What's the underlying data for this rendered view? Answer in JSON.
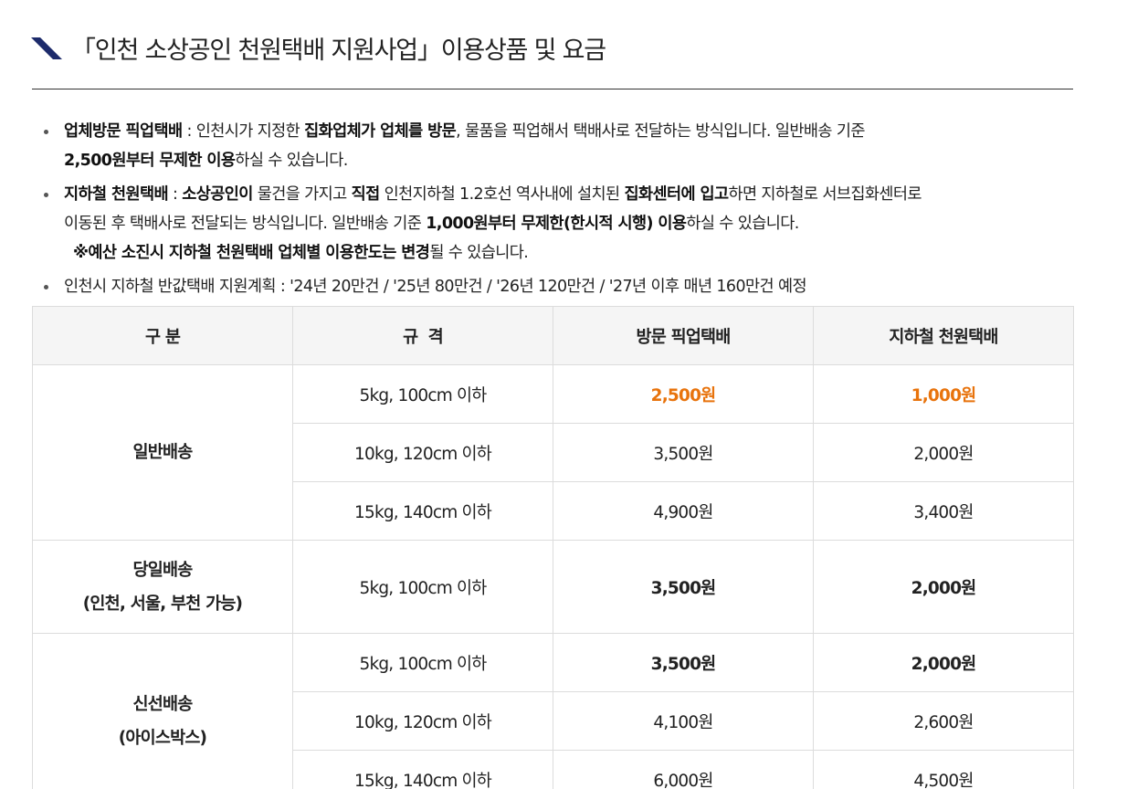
{
  "title": "「인천 소상공인 천원택배 지원사업」이용상품 및 요금",
  "accent_color": "#e8730c",
  "mark_color": "#1d2b6b",
  "bullets": {
    "b1": {
      "label": "업체방문 픽업택배",
      "sep": " : 인천시가 지정한 ",
      "bold1": "집화업체가 업체를 방문",
      "rest1": ", 물품을 픽업해서 택배사로 전달하는 방식입니다. 일반배송 기준",
      "bold2": "2,500원부터 무제한 이용",
      "rest2": "하실 수 있습니다."
    },
    "b2": {
      "label": "지하철 천원택배",
      "sep": " : ",
      "bold1": "소상공인이",
      "rest1": " 물건을 가지고 ",
      "bold2": "직접",
      "rest2": " 인천지하철 1.2호선 역사내에 설치된 ",
      "bold3": "집화센터에 입고",
      "rest3": "하면 지하철로 서브집화센터로",
      "line2_a": "이동된 후 택배사로 전달되는 방식입니다. 일반배송 기준 ",
      "line2_bold": "1,000원부터 무제한(한시적 시행) 이용",
      "line2_b": "하실 수 있습니다.",
      "note_bold": "※예산 소진시 지하철 천원택배 업체별 이용한도는 변경",
      "note_rest": "될 수 있습니다."
    },
    "b3": {
      "text": "인천시 지하철 반값택배 지원계획 : '24년 20만건 / '25년 80만건 / '26년 120만건 / '27년 이후 매년 160만건 예정"
    }
  },
  "table": {
    "headers": [
      "구 분",
      "규  격",
      "방문 픽업택배",
      "지하철 천원택배"
    ],
    "groups": {
      "normal": {
        "category": "일반배송",
        "rows": [
          {
            "spec": "5kg, 100cm 이하",
            "pickup": "2,500원",
            "subway": "1,000원"
          },
          {
            "spec": "10kg, 120cm 이하",
            "pickup": "3,500원",
            "subway": "2,000원"
          },
          {
            "spec": "15kg, 140cm 이하",
            "pickup": "4,900원",
            "subway": "3,400원"
          }
        ]
      },
      "sameday": {
        "category_line1": "당일배송",
        "category_line2": "(인천, 서울, 부천 가능)",
        "rows": [
          {
            "spec": "5kg, 100cm 이하",
            "pickup": "3,500원",
            "subway": "2,000원"
          }
        ]
      },
      "fresh": {
        "category_line1": "신선배송",
        "category_line2": "(아이스박스)",
        "rows": [
          {
            "spec": "5kg, 100cm 이하",
            "pickup": "3,500원",
            "subway": "2,000원"
          },
          {
            "spec": "10kg, 120cm 이하",
            "pickup": "4,100원",
            "subway": "2,600원"
          },
          {
            "spec": "15kg, 140cm 이하",
            "pickup": "6,000원",
            "subway": "4,500원"
          }
        ]
      }
    }
  }
}
